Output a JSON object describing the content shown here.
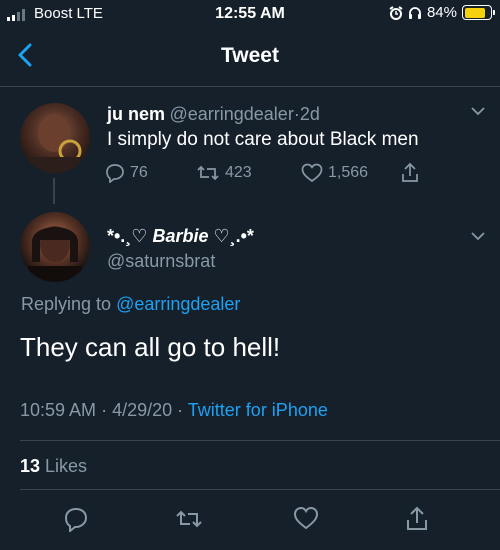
{
  "status_bar": {
    "carrier": "Boost  LTE",
    "time": "12:55 AM",
    "battery": "84%",
    "signal_bars_active": 2,
    "signal_bars_total": 4
  },
  "nav": {
    "title": "Tweet"
  },
  "tweet_1": {
    "name": "ju nem",
    "handle": "@earringdealer",
    "dot": "·",
    "age": "2d",
    "text": "I simply do not care about Black men",
    "replies": "76",
    "retweets": "423",
    "likes": "1,566"
  },
  "tweet_2": {
    "name_prefix": "*•.¸♡ ",
    "name_main": "Barbie",
    "name_suffix": " ♡¸.•*",
    "handle": "@saturnsbrat",
    "replying_label": "Replying to ",
    "replying_handle": "@earringdealer",
    "text": "They can all go to hell!",
    "time": "10:59 AM",
    "sep1": " · ",
    "date": "4/29/20",
    "sep2": " · ",
    "client": "Twitter for iPhone",
    "likes_count": "13",
    "likes_label": " Likes"
  },
  "colors": {
    "background": "#15202b",
    "accent": "#1da1f2",
    "muted": "#8899a6",
    "divider": "#38444d",
    "battery": "#f5d20d"
  },
  "icons": [
    "back-chevron-icon",
    "reply-icon",
    "retweet-icon",
    "heart-icon",
    "share-icon",
    "chevron-down-icon",
    "alarm-icon",
    "headphones-icon",
    "battery-icon",
    "signal-icon"
  ]
}
